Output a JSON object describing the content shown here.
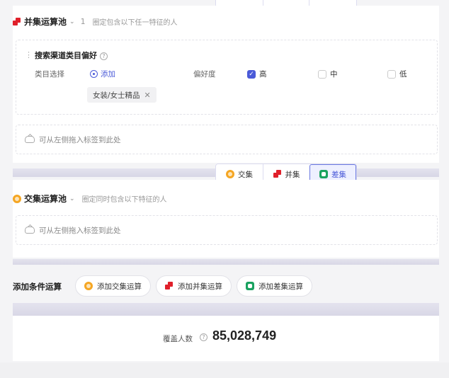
{
  "union_pool": {
    "title": "并集运算池",
    "count": "1",
    "desc": "圈定包含以下任一特征的人",
    "condition": {
      "title": "搜索渠道类目偏好",
      "category_label": "类目选择",
      "add_label": "添加",
      "preference_label": "偏好度",
      "levels": [
        {
          "label": "高",
          "checked": true
        },
        {
          "label": "中",
          "checked": false
        },
        {
          "label": "低",
          "checked": false
        }
      ],
      "tag": "女装/女士精品"
    },
    "drop_hint": "可从左侧拖入标签到此处"
  },
  "operator_group": {
    "buttons": [
      {
        "label": "交集",
        "icon": "intersection-icon"
      },
      {
        "label": "并集",
        "icon": "union-icon"
      },
      {
        "label": "差集",
        "icon": "difference-icon",
        "active": true
      }
    ]
  },
  "intersection_pool": {
    "title": "交集运算池",
    "desc": "圈定同时包含以下特征的人",
    "drop_hint": "可从左侧拖入标签到此处"
  },
  "add_operation": {
    "title": "添加条件运算",
    "buttons": [
      {
        "label": "添加交集运算",
        "icon": "intersection-icon"
      },
      {
        "label": "添加并集运算",
        "icon": "union-icon"
      },
      {
        "label": "添加差集运算",
        "icon": "difference-icon"
      }
    ]
  },
  "coverage": {
    "label": "覆盖人数",
    "value": "85,028,749"
  },
  "colors": {
    "accent": "#4a5ad8",
    "union": "#e0202b",
    "intersection": "#f5a623",
    "difference": "#1aa260"
  }
}
